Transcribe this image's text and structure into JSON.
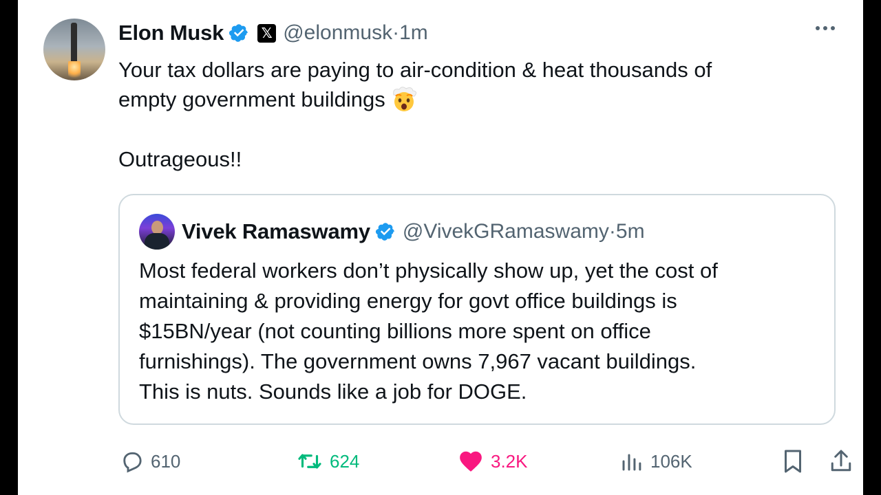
{
  "tweet": {
    "author_name": "Elon Musk",
    "author_handle": "@elonmusk",
    "time_sep": " · ",
    "time": "1m",
    "text_line1": "Your tax dollars are paying to air-condition & heat thousands of",
    "text_line2": "empty government buildings",
    "text_line3": "Outrageous!!",
    "emoji": "exploding-head-emoji"
  },
  "quote": {
    "author_name": "Vivek Ramaswamy",
    "author_handle": "@VivekGRamaswamy",
    "time_sep": " · ",
    "time": "5m",
    "lines": [
      "Most federal workers don’t physically show up, yet the cost of",
      "maintaining & providing energy for govt office buildings is",
      "$15BN/year (not counting billions more spent on office",
      "furnishings). The government owns 7,967 vacant buildings.",
      "This is nuts. Sounds like a job for DOGE."
    ]
  },
  "actions": {
    "replies": "610",
    "reposts": "624",
    "likes": "3.2K",
    "views": "106K"
  },
  "colors": {
    "verified": "#1d9bf0",
    "repost_active": "#00ba7c",
    "like_active": "#f91880",
    "secondary_text": "#536471",
    "border": "#cfd9de"
  }
}
